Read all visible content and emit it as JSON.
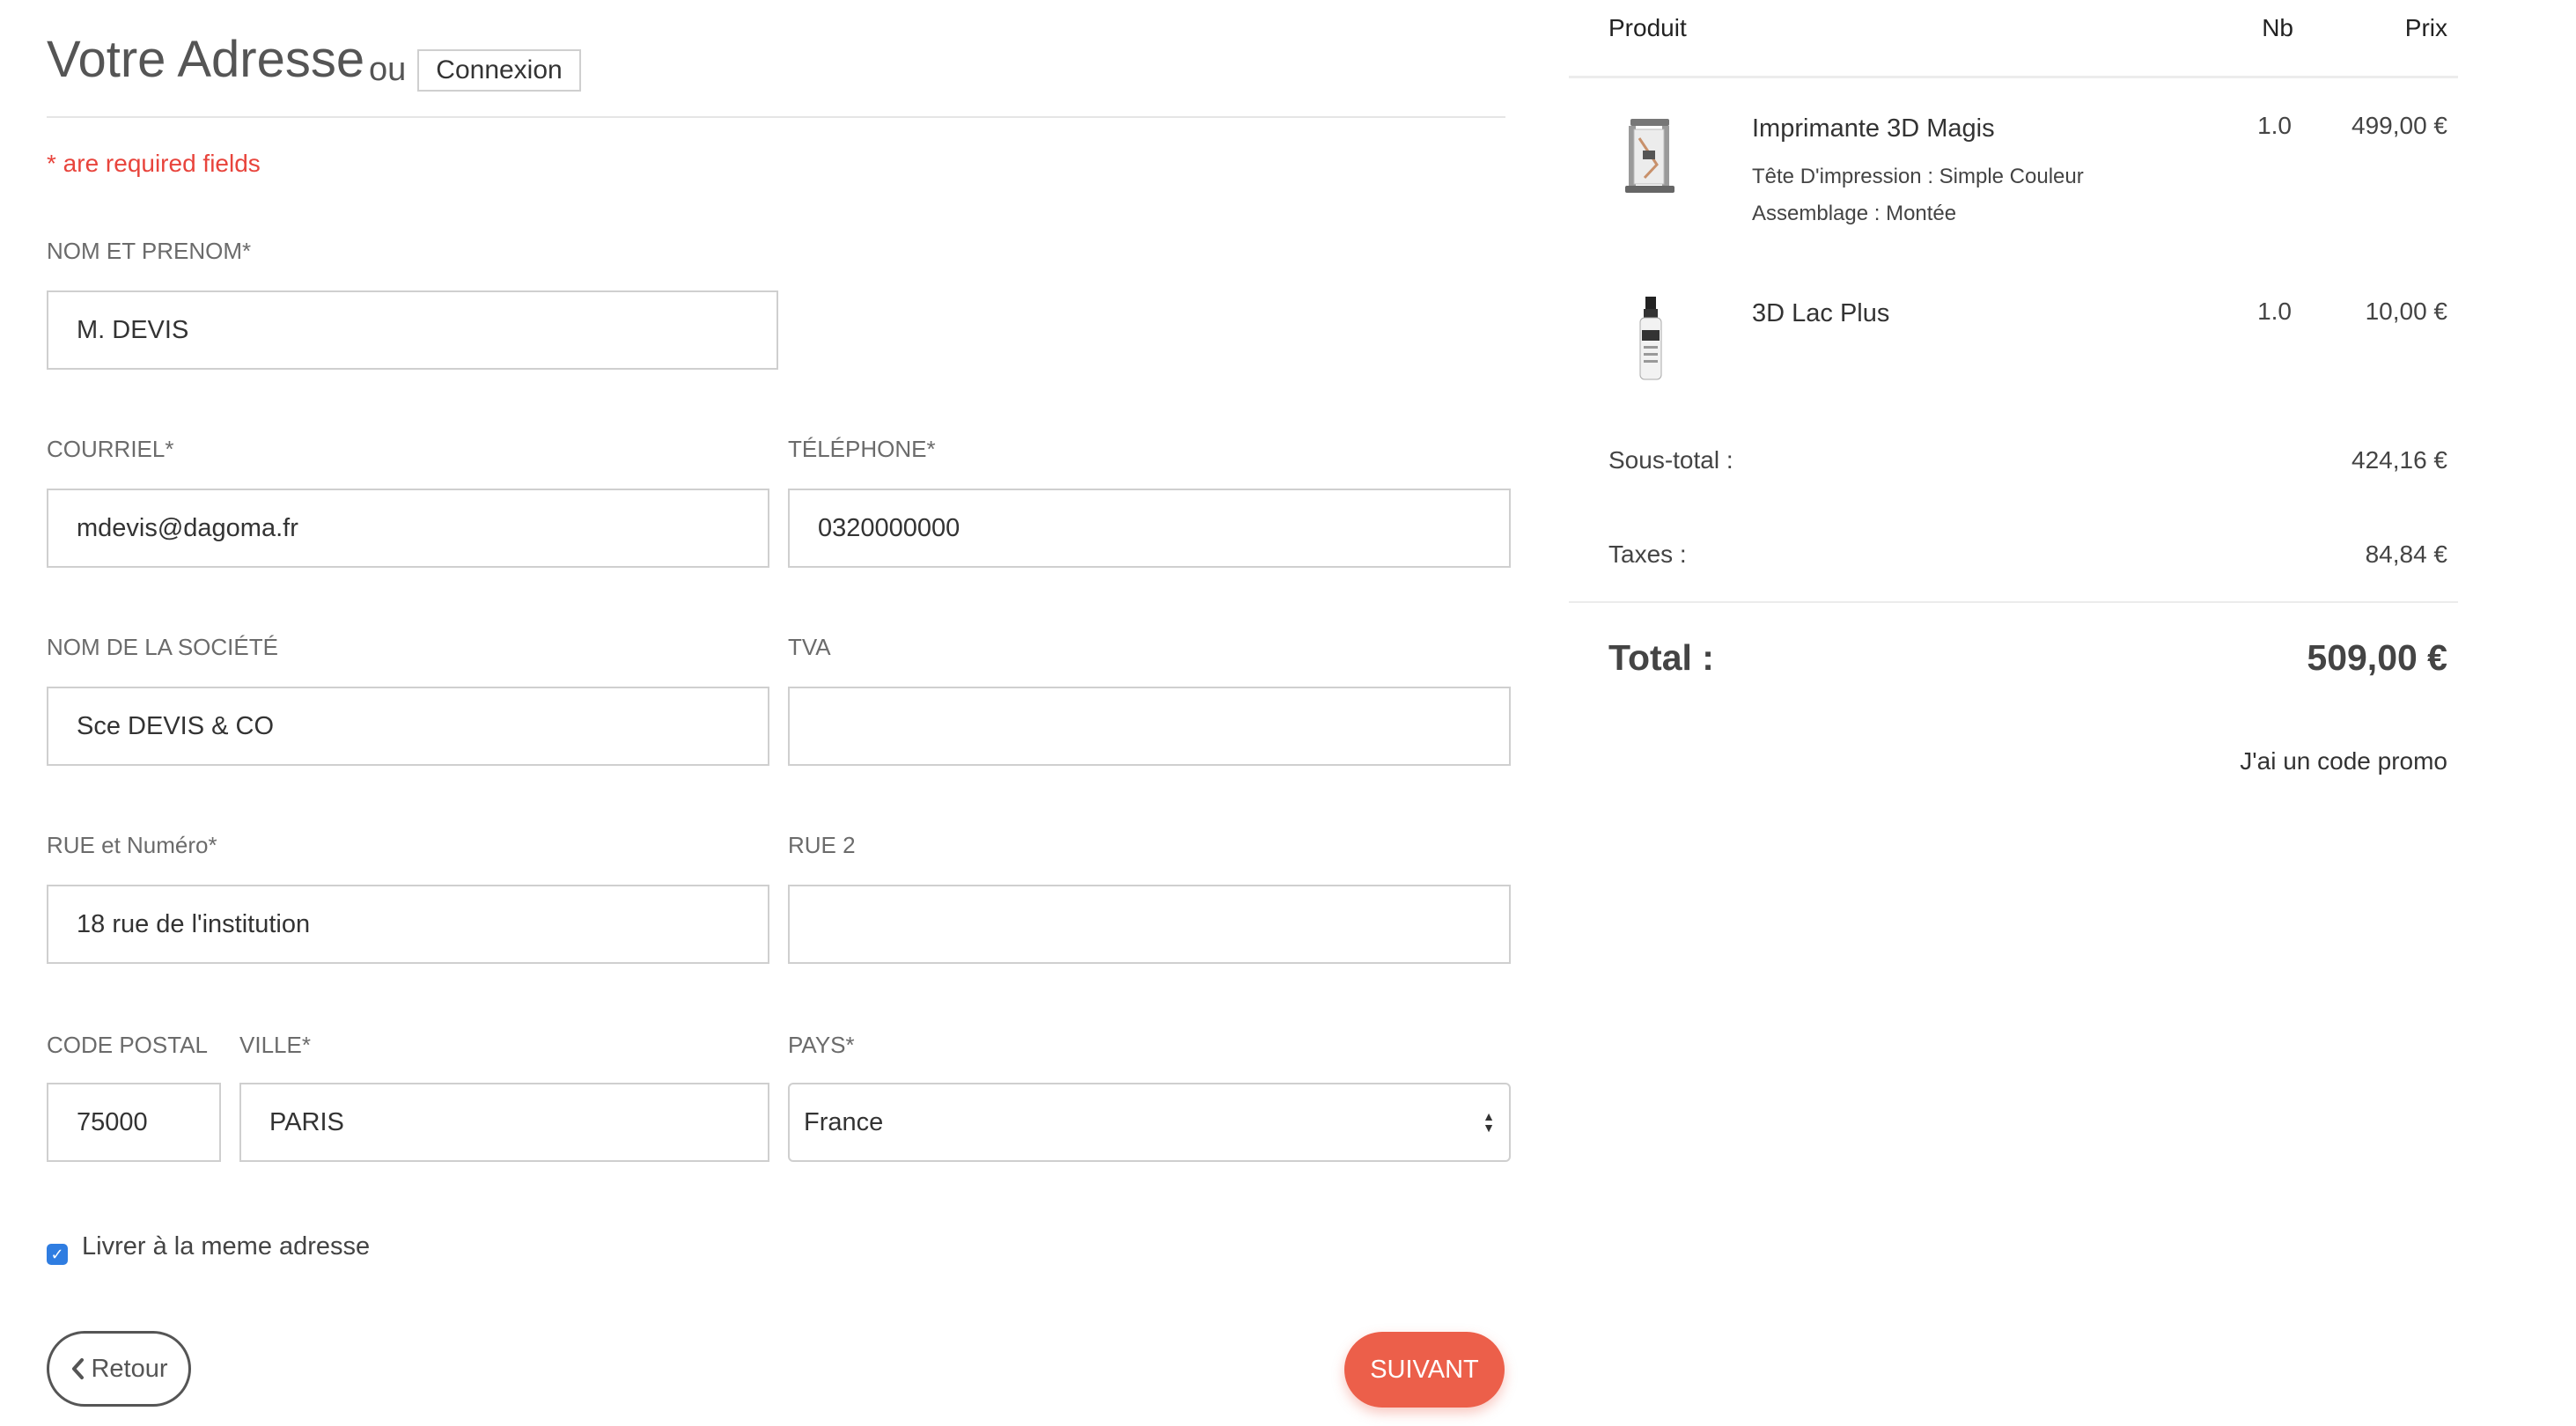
{
  "header": {
    "title": "Votre Adresse",
    "or": "ou",
    "login_label": "Connexion",
    "required_note": "* are required fields"
  },
  "form": {
    "name": {
      "label": "NOM ET PRENOM*",
      "value": "M. DEVIS"
    },
    "email": {
      "label": "COURRIEL*",
      "value": "mdevis@dagoma.fr"
    },
    "phone": {
      "label": "TÉLÉPHONE*",
      "value": "0320000000"
    },
    "company": {
      "label": "NOM DE LA SOCIÉTÉ",
      "value": "Sce DEVIS & CO"
    },
    "vat": {
      "label": "TVA",
      "value": ""
    },
    "street": {
      "label": "RUE et Numéro*",
      "value": "18 rue de l'institution"
    },
    "street2": {
      "label": "RUE 2",
      "value": ""
    },
    "postal": {
      "label": "CODE POSTAL",
      "value": "75000"
    },
    "city": {
      "label": "VILLE*",
      "value": "PARIS"
    },
    "country": {
      "label": "PAYS*",
      "value": "France"
    },
    "same_address": {
      "label": "Livrer à la meme adresse",
      "checked": true
    },
    "back_label": "Retour",
    "next_label": "SUIVANT"
  },
  "cart": {
    "headers": {
      "product": "Produit",
      "qty": "Nb",
      "price": "Prix"
    },
    "items": [
      {
        "name": "Imprimante 3D Magis",
        "options": [
          "Tête D'impression : Simple Couleur",
          "Assemblage : Montée"
        ],
        "qty": "1.0",
        "price": "499,00 €",
        "icon": "printer-icon"
      },
      {
        "name": "3D Lac Plus",
        "options": [],
        "qty": "1.0",
        "price": "10,00 €",
        "icon": "spray-bottle-icon"
      }
    ],
    "subtotal_label": "Sous-total :",
    "subtotal": "424,16 €",
    "taxes_label": "Taxes :",
    "taxes": "84,84 €",
    "total_label": "Total :",
    "total": "509,00 €",
    "promo_label": "J'ai un code promo"
  },
  "colors": {
    "accent": "#ec5f4a",
    "required": "#e8443c",
    "checkbox": "#2f7de1"
  }
}
